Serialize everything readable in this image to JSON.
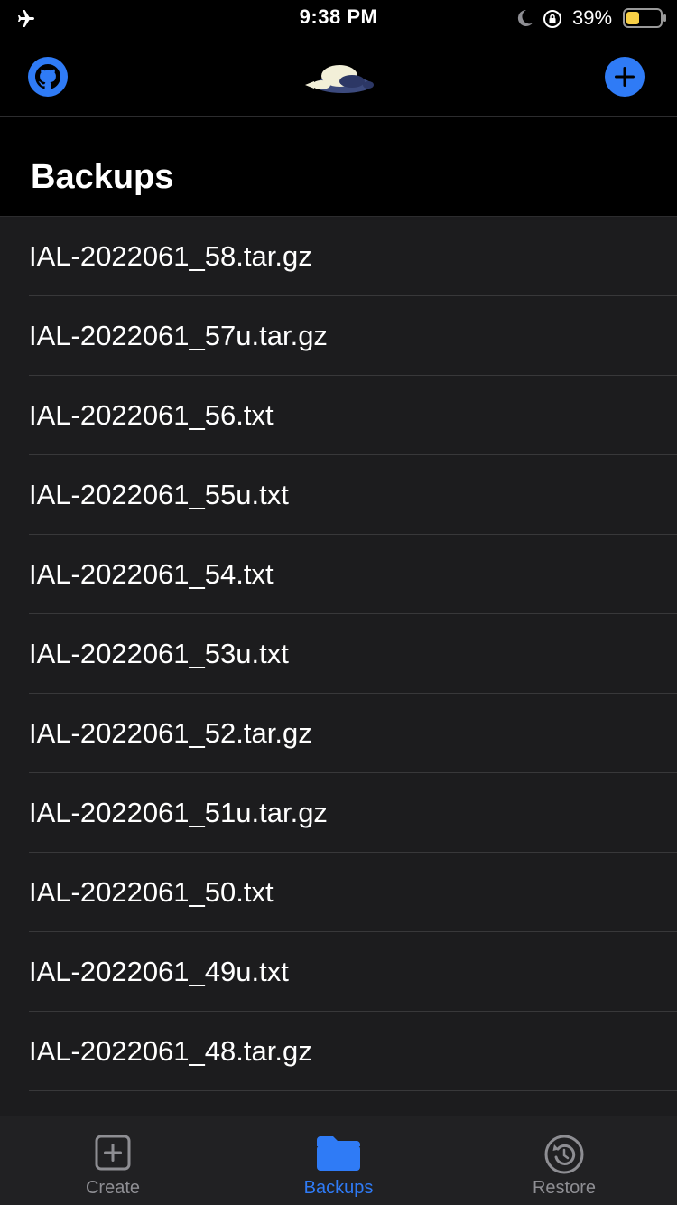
{
  "status_bar": {
    "time": "9:38 PM",
    "battery_percent": "39%",
    "battery_level": 0.39,
    "icons": [
      "airplane-icon",
      "moon-icon",
      "orientation-lock-icon",
      "battery-icon"
    ]
  },
  "nav": {
    "left_icon": "github-icon",
    "center_icon": "mascot-logo",
    "right_icon": "plus-circle-icon"
  },
  "page": {
    "title": "Backups"
  },
  "backups": [
    "IAL-2022061_58.tar.gz",
    "IAL-2022061_57u.tar.gz",
    "IAL-2022061_56.txt",
    "IAL-2022061_55u.txt",
    "IAL-2022061_54.txt",
    "IAL-2022061_53u.txt",
    "IAL-2022061_52.tar.gz",
    "IAL-2022061_51u.tar.gz",
    "IAL-2022061_50.txt",
    "IAL-2022061_49u.txt",
    "IAL-2022061_48.tar.gz"
  ],
  "tabs": [
    {
      "label": "Create",
      "icon": "plus-square-icon",
      "active": false
    },
    {
      "label": "Backups",
      "icon": "folder-icon",
      "active": true
    },
    {
      "label": "Restore",
      "icon": "restore-icon",
      "active": false
    }
  ],
  "colors": {
    "accent": "#2f7bf6",
    "background": "#000000",
    "list_background": "#1c1c1e",
    "battery_fill": "#f7cf46",
    "inactive_tab": "#8e8e93"
  }
}
